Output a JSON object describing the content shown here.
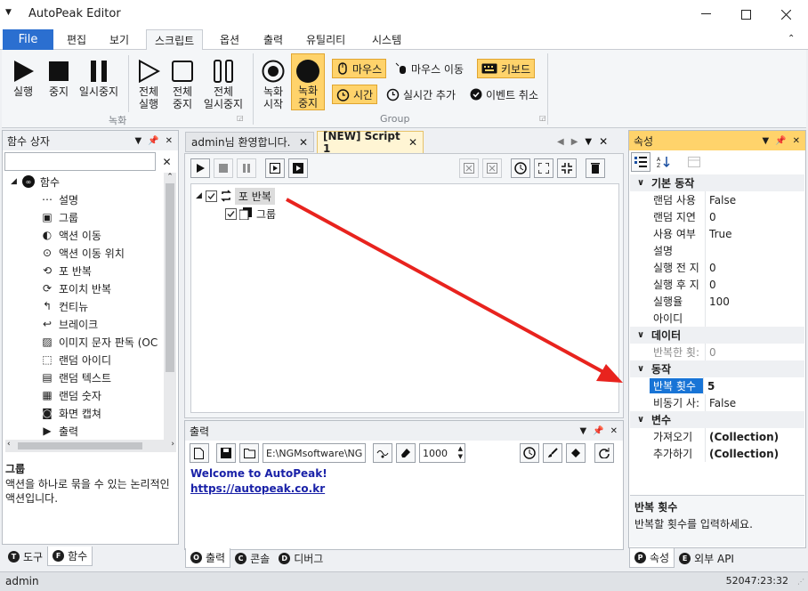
{
  "app": {
    "title": "AutoPeak Editor"
  },
  "ribbon_tabs": [
    "File",
    "편집",
    "보기",
    "스크립트",
    "옵션",
    "출력",
    "유틸리티",
    "시스템"
  ],
  "ribbon": {
    "play": "실행",
    "stop": "중지",
    "pause": "일시중지",
    "all_run": "전체\n실행",
    "all_stop": "전체\n중지",
    "all_pause": "전체\n일시중지",
    "rec_start": "녹화\n시작",
    "rec_stop": "녹화\n중지",
    "group1_label": "녹화",
    "mouse_click": "마우스",
    "mouse_move": "마우스 이동",
    "keyboard": "키보드",
    "time": "시간",
    "realtime_add": "실시간 추가",
    "event_cancel": "이벤트 취소",
    "group2_label": "Group"
  },
  "left_panel": {
    "title": "함수 상자",
    "root": "함수",
    "items": [
      "설명",
      "그룹",
      "액션 이동",
      "액션 이동 위치",
      "포 반복",
      "포이치 반복",
      "컨티뉴",
      "브레이크",
      "이미지 문자 판독 (OC",
      "랜덤 아이디",
      "랜덤 텍스트",
      "랜덤 숫자",
      "화면 캡쳐",
      "출력"
    ],
    "desc_title": "그룹",
    "desc_text": "액션을 하나로 묶을 수 있는 논리적인 액션입니다.",
    "tabs": [
      {
        "icon": "T",
        "label": "도구"
      },
      {
        "icon": "F",
        "label": "함수"
      }
    ]
  },
  "doc_tabs": [
    {
      "label": "admin님 환영합니다."
    },
    {
      "label": "[NEW] Script 1"
    }
  ],
  "script_tree": {
    "root": "포 반복",
    "child": "그룹"
  },
  "output": {
    "title": "출력",
    "path": "E:\\NGMsoftware\\NG",
    "count": "1000",
    "welcome": "Welcome to AutoPeak!",
    "link": "https://autopeak.co.kr",
    "tabs": [
      {
        "icon": "O",
        "label": "출력"
      },
      {
        "icon": "C",
        "label": "콘솔"
      },
      {
        "icon": "D",
        "label": "디버그"
      }
    ]
  },
  "properties": {
    "title": "속성",
    "categories": [
      {
        "name": "기본 동작",
        "rows": [
          {
            "name": "랜덤 사용",
            "value": "False"
          },
          {
            "name": "랜덤 지연",
            "value": "0"
          },
          {
            "name": "사용 여부",
            "value": "True"
          },
          {
            "name": "설명",
            "value": ""
          },
          {
            "name": "실행 전 지",
            "value": "0"
          },
          {
            "name": "실행 후 지",
            "value": "0"
          },
          {
            "name": "실행율",
            "value": "100"
          },
          {
            "name": "아이디",
            "value": ""
          }
        ]
      },
      {
        "name": "데이터",
        "rows": [
          {
            "name": "반복한 횟:",
            "value": "0"
          }
        ]
      },
      {
        "name": "동작",
        "rows": [
          {
            "name": "반복 횟수",
            "value": "5"
          },
          {
            "name": "비동기 사:",
            "value": "False"
          }
        ]
      },
      {
        "name": "변수",
        "rows": [
          {
            "name": "가져오기",
            "value": "(Collection)"
          },
          {
            "name": "추가하기",
            "value": "(Collection)"
          }
        ]
      }
    ],
    "desc_title": "반복 횟수",
    "desc_text": "반복할 횟수를 입력하세요.",
    "tabs": [
      {
        "icon": "P",
        "label": "속성"
      },
      {
        "icon": "E",
        "label": "외부 API"
      }
    ]
  },
  "status": {
    "user": "admin",
    "time": "52047:23:32"
  },
  "colors": {
    "accent": "#2b6fd0",
    "highlight": "#ffd36b",
    "arrow": "#e8231e",
    "selected": "#1874d6"
  }
}
